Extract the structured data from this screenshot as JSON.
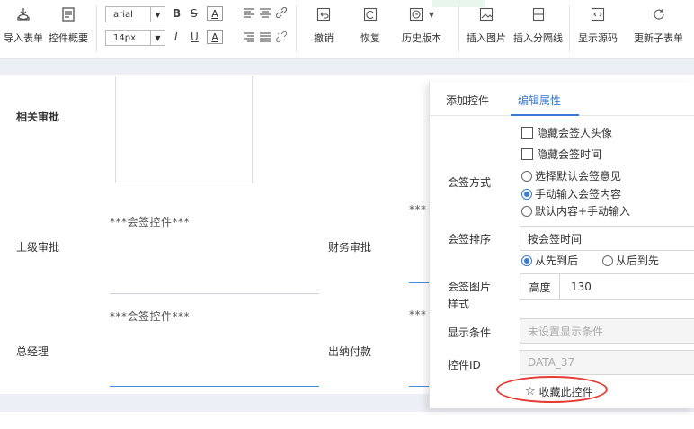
{
  "toolbar": {
    "import_form": "导入表单",
    "control_overview": "控件概要",
    "font_family": "arial",
    "font_size": "14px",
    "bold": "B",
    "strike": "S",
    "color_a": "A",
    "italic": "I",
    "underline": "U",
    "bg_a": "A",
    "undo": "撤销",
    "redo": "恢复",
    "history": "历史版本",
    "insert_image": "插入图片",
    "insert_divider": "插入分隔线",
    "show_source": "显示源码",
    "update_subform": "更新子表单"
  },
  "form": {
    "related_approval": "相关审批",
    "superior_approval": "上级审批",
    "finance_approval": "财务审批",
    "general_manager": "总经理",
    "cashier_payment": "出纳付款",
    "countersign_placeholder_1": "***会签控件***",
    "countersign_placeholder_2": "***会签控件***",
    "truncated_1": "***",
    "truncated_2": "***"
  },
  "panel": {
    "tabs": [
      "添加控件",
      "编辑属性"
    ],
    "active_tab": 1,
    "hide_avatar": "隐藏会签人头像",
    "hide_time": "隐藏会签时间",
    "countersign_mode_label": "会签方式",
    "mode_options": [
      "选择默认会签意见",
      "手动输入会签内容",
      "默认内容+手动输入"
    ],
    "mode_selected": 1,
    "sort_label": "会签排序",
    "sort_value": "按会签时间",
    "sort_options": [
      "从先到后",
      "从后到先"
    ],
    "sort_selected": 0,
    "image_style_label_1": "会签图片",
    "image_style_label_2": "样式",
    "height_label": "高度",
    "height_value": "130",
    "display_condition_label": "显示条件",
    "display_condition_placeholder": "未设置显示条件",
    "control_id_label": "控件ID",
    "control_id_value": "DATA_37",
    "favorite_label": "收藏此控件"
  },
  "colors": {
    "accent": "#3a7bd5",
    "highlight_ellipse": "#e53b35"
  }
}
